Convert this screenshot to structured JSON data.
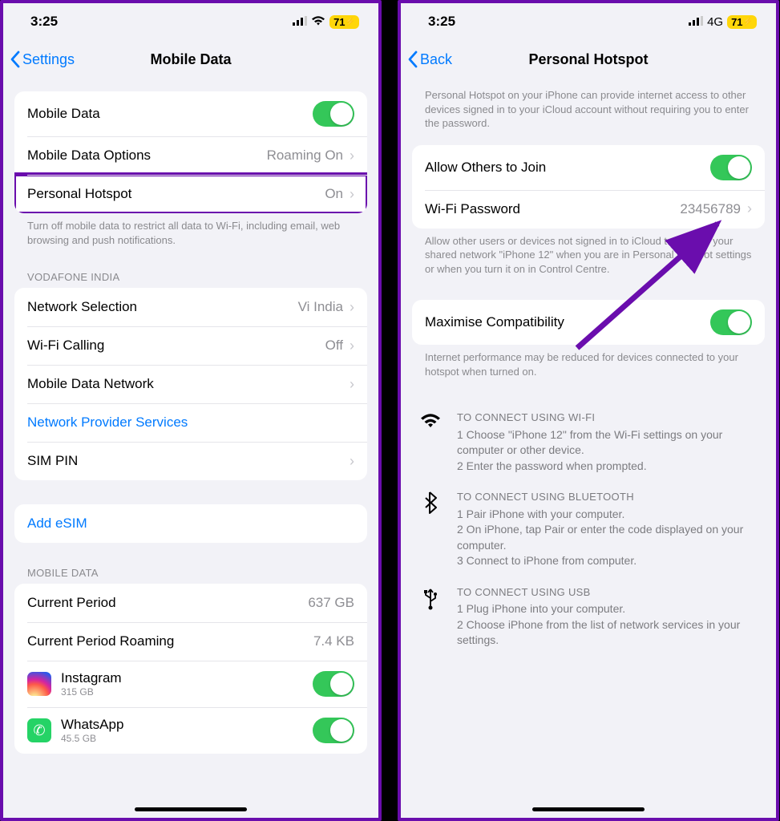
{
  "left": {
    "status": {
      "time": "3:25",
      "battery": "71"
    },
    "nav": {
      "back": "Settings",
      "title": "Mobile Data"
    },
    "group1": {
      "mobile_data": "Mobile Data",
      "mobile_data_options": "Mobile Data Options",
      "mobile_data_options_detail": "Roaming On",
      "personal_hotspot": "Personal Hotspot",
      "personal_hotspot_detail": "On",
      "footer": "Turn off mobile data to restrict all data to Wi-Fi, including email, web browsing and push notifications."
    },
    "carrier_header": "VODAFONE INDIA",
    "carrier": {
      "network_selection": "Network Selection",
      "network_selection_detail": "Vi India",
      "wifi_calling": "Wi-Fi Calling",
      "wifi_calling_detail": "Off",
      "mobile_data_network": "Mobile Data Network",
      "network_provider_services": "Network Provider Services",
      "sim_pin": "SIM PIN"
    },
    "add_esim": "Add eSIM",
    "usage_header": "MOBILE DATA",
    "usage": {
      "current_period": "Current Period",
      "current_period_val": "637 GB",
      "current_period_roaming": "Current Period Roaming",
      "current_period_roaming_val": "7.4 KB",
      "instagram": "Instagram",
      "instagram_size": "315 GB",
      "whatsapp": "WhatsApp",
      "whatsapp_size": "45.5 GB"
    }
  },
  "right": {
    "status": {
      "time": "3:25",
      "network": "4G",
      "battery": "71"
    },
    "nav": {
      "back": "Back",
      "title": "Personal Hotspot"
    },
    "intro": "Personal Hotspot on your iPhone can provide internet access to other devices signed in to your iCloud account without requiring you to enter the password.",
    "allow_others": "Allow Others to Join",
    "wifi_password": "Wi-Fi Password",
    "wifi_password_val": "23456789",
    "allow_footer": "Allow other users or devices not signed in to iCloud to look for your shared network \"iPhone 12\" when you are in Personal Hotspot settings or when you turn it on in Control Centre.",
    "maximise": "Maximise Compatibility",
    "maximise_footer": "Internet performance may be reduced for devices connected to your hotspot when turned on.",
    "wifi_title": "TO CONNECT USING WI-FI",
    "wifi_step1": "1 Choose \"iPhone 12\" from the Wi-Fi settings on your computer or other device.",
    "wifi_step2": "2 Enter the password when prompted.",
    "bt_title": "TO CONNECT USING BLUETOOTH",
    "bt_step1": "1 Pair iPhone with your computer.",
    "bt_step2": "2 On iPhone, tap Pair or enter the code displayed on your computer.",
    "bt_step3": "3 Connect to iPhone from computer.",
    "usb_title": "TO CONNECT USING USB",
    "usb_step1": "1 Plug iPhone into your computer.",
    "usb_step2": "2 Choose iPhone from the list of network services in your settings."
  }
}
